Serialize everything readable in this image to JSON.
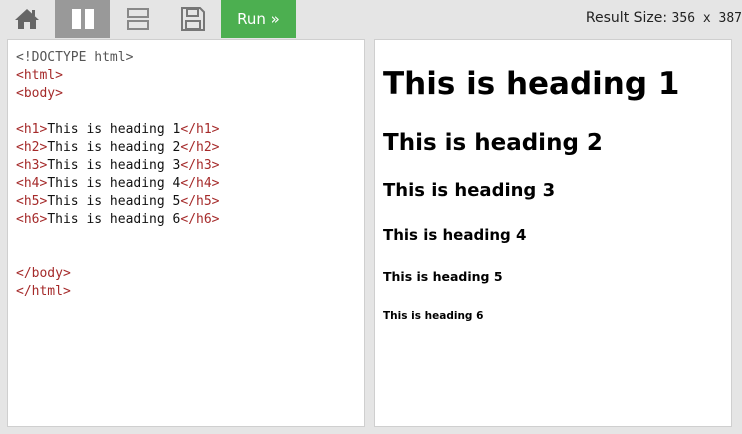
{
  "toolbar": {
    "home_icon": "home-icon",
    "split_icon": "split-view-icon",
    "stack_icon": "stacked-view-icon",
    "save_icon": "save-icon",
    "run_label": "Run »",
    "result_size_label": "Result Size:",
    "result_size_value": "356 x 387",
    "colors": {
      "toolbar_bg": "#e5e5e5",
      "active_view_bg": "#999999",
      "run_bg": "#4caf50"
    }
  },
  "code": {
    "lines": [
      [
        {
          "t": "doctype",
          "v": "<!DOCTYPE html>"
        }
      ],
      [
        {
          "t": "tag",
          "v": "<html>"
        }
      ],
      [
        {
          "t": "tag",
          "v": "<body>"
        }
      ],
      [],
      [
        {
          "t": "tag",
          "v": "<h1>"
        },
        {
          "t": "txt",
          "v": "This is heading 1"
        },
        {
          "t": "tag",
          "v": "</h1>"
        }
      ],
      [
        {
          "t": "tag",
          "v": "<h2>"
        },
        {
          "t": "txt",
          "v": "This is heading 2"
        },
        {
          "t": "tag",
          "v": "</h2>"
        }
      ],
      [
        {
          "t": "tag",
          "v": "<h3>"
        },
        {
          "t": "txt",
          "v": "This is heading 3"
        },
        {
          "t": "tag",
          "v": "</h3>"
        }
      ],
      [
        {
          "t": "tag",
          "v": "<h4>"
        },
        {
          "t": "txt",
          "v": "This is heading 4"
        },
        {
          "t": "tag",
          "v": "</h4>"
        }
      ],
      [
        {
          "t": "tag",
          "v": "<h5>"
        },
        {
          "t": "txt",
          "v": "This is heading 5"
        },
        {
          "t": "tag",
          "v": "</h5>"
        }
      ],
      [
        {
          "t": "tag",
          "v": "<h6>"
        },
        {
          "t": "txt",
          "v": "This is heading 6"
        },
        {
          "t": "tag",
          "v": "</h6>"
        }
      ],
      [],
      [],
      [
        {
          "t": "tag",
          "v": "</body>"
        }
      ],
      [
        {
          "t": "tag",
          "v": "</html>"
        }
      ]
    ],
    "colors": {
      "tag": "#a52a2a",
      "doctype": "#555555",
      "text": "#111111"
    }
  },
  "result": {
    "h1": "This is heading 1",
    "h2": "This is heading 2",
    "h3": "This is heading 3",
    "h4": "This is heading 4",
    "h5": "This is heading 5",
    "h6": "This is heading 6"
  }
}
